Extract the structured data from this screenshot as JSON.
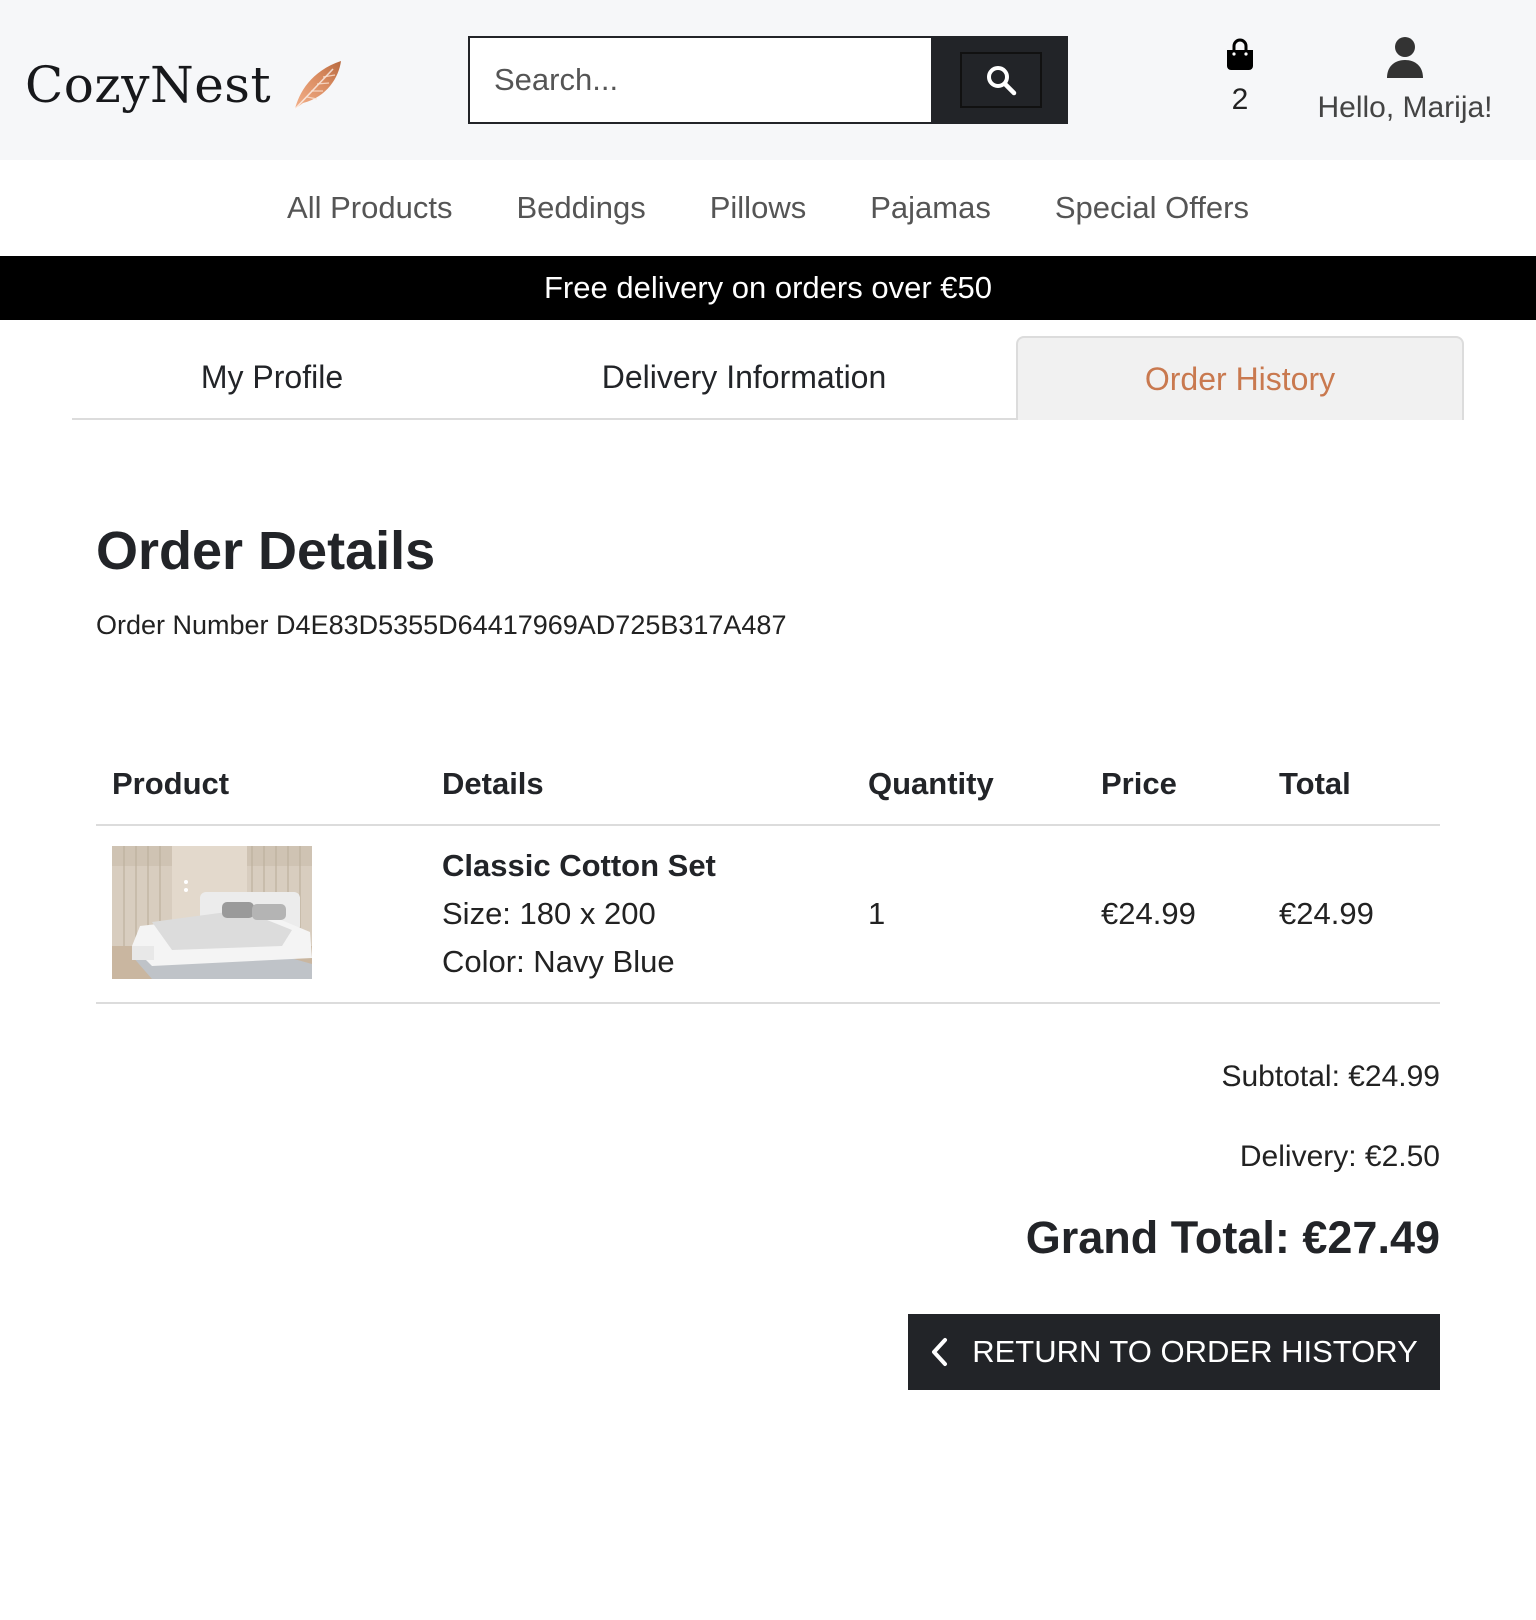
{
  "header": {
    "brand": "CozyNest",
    "brand_icon": "feather-icon",
    "search": {
      "placeholder": "Search...",
      "value": ""
    },
    "cart": {
      "icon": "shopping-bag-icon",
      "count": "2"
    },
    "account": {
      "icon": "user-icon",
      "greeting": "Hello, Marija!"
    }
  },
  "nav": {
    "items": [
      "All Products",
      "Beddings",
      "Pillows",
      "Pajamas",
      "Special Offers"
    ]
  },
  "banner": {
    "text": "Free delivery on orders over €50"
  },
  "tabs": [
    {
      "label": "My Profile",
      "active": false
    },
    {
      "label": "Delivery Information",
      "active": false
    },
    {
      "label": "Order History",
      "active": true
    }
  ],
  "order": {
    "title": "Order Details",
    "number_text": "Order Number D4E83D5355D64417969AD725B317A487",
    "columns": [
      "Product",
      "Details",
      "Quantity",
      "Price",
      "Total"
    ],
    "items": [
      {
        "name": "Classic Cotton Set",
        "size": "Size: 180 x 200",
        "color": "Color: Navy Blue",
        "quantity": "1",
        "price": "€24.99",
        "total": "€24.99"
      }
    ],
    "subtotal": "Subtotal: €24.99",
    "delivery": "Delivery: €2.50",
    "grand_total": "Grand Total: €27.49",
    "return_label": "RETURN TO ORDER HISTORY"
  },
  "colors": {
    "dark": "#222428",
    "accent": "#c9794f",
    "banner_bg": "#000000",
    "topbar_bg": "#f6f7f9"
  }
}
